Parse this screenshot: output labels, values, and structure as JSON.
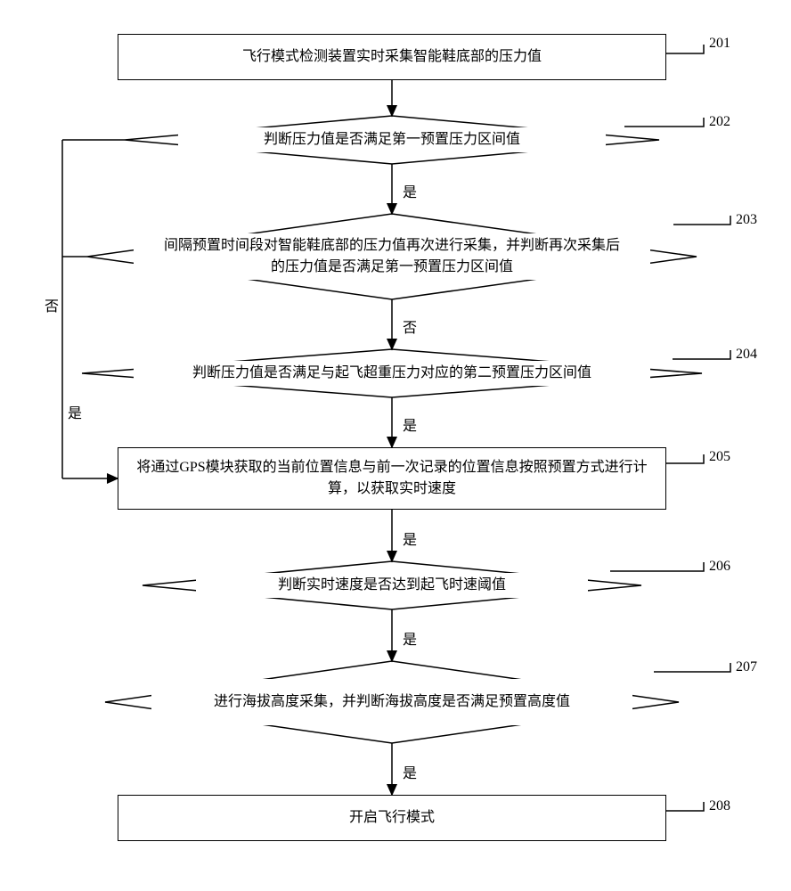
{
  "chart_data": {
    "type": "flowchart",
    "title": "",
    "nodes": [
      {
        "id": 201,
        "type": "process",
        "text": "飞行模式检测装置实时采集智能鞋底部的压力值"
      },
      {
        "id": 202,
        "type": "decision",
        "text": "判断压力值是否满足第一预置压力区间值"
      },
      {
        "id": 203,
        "type": "decision",
        "text": "间隔预置时间段对智能鞋底部的压力值再次进行采集，并判断再次采集后的压力值是否满足第一预置压力区间值"
      },
      {
        "id": 204,
        "type": "decision",
        "text": "判断压力值是否满足与起飞超重压力对应的第二预置压力区间值"
      },
      {
        "id": 205,
        "type": "process",
        "text": "将通过GPS模块获取的当前位置信息与前一次记录的位置信息按照预置方式进行计算，以获取实时速度"
      },
      {
        "id": 206,
        "type": "decision",
        "text": "判断实时速度是否达到起飞时速阈值"
      },
      {
        "id": 207,
        "type": "decision",
        "text": "进行海拔高度采集，并判断海拔高度是否满足预置高度值"
      },
      {
        "id": 208,
        "type": "process",
        "text": "开启飞行模式"
      }
    ],
    "edges": [
      {
        "from": 201,
        "to": 202,
        "label": ""
      },
      {
        "from": 202,
        "to": 203,
        "label": "是"
      },
      {
        "from": 202,
        "to": 205,
        "label": "否",
        "path": "loop-left"
      },
      {
        "from": 203,
        "to": 204,
        "label": "否"
      },
      {
        "from": 203,
        "to": 205,
        "label": "是",
        "path": "loop-left"
      },
      {
        "from": 204,
        "to": 205,
        "label": "是"
      },
      {
        "from": 205,
        "to": 206,
        "label": "是"
      },
      {
        "from": 206,
        "to": 207,
        "label": "是"
      },
      {
        "from": 207,
        "to": 208,
        "label": "是"
      }
    ]
  },
  "labels": {
    "yes": "是",
    "no": "否"
  },
  "refs": {
    "n201": "201",
    "n202": "202",
    "n203": "203",
    "n204": "204",
    "n205": "205",
    "n206": "206",
    "n207": "207",
    "n208": "208"
  }
}
